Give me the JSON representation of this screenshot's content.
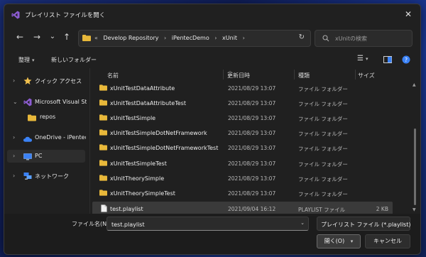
{
  "dialog": {
    "title": "プレイリスト ファイルを開く",
    "close_glyph": "✕"
  },
  "nav": {
    "back": "←",
    "forward": "→",
    "recent": "⌄",
    "up": "↑",
    "breadcrumb_prefix": "«",
    "breadcrumbs": [
      "Develop Repository",
      "iPentecDemo",
      "xUnit"
    ],
    "breadcrumb_sep": "›",
    "refresh": "↻",
    "search_placeholder": "xUnitの検索"
  },
  "commands": {
    "organize": "整理",
    "organize_caret": "▾",
    "new_folder": "新しいフォルダー",
    "view": "☰",
    "view_caret": "▾"
  },
  "sidebar": {
    "items": [
      {
        "label": "クイック アクセス",
        "chevron": "›"
      },
      {
        "label": "Microsoft Visual Stu",
        "chevron": "⌄"
      },
      {
        "label": "repos",
        "chevron": ""
      },
      {
        "label": "OneDrive - iPentec",
        "chevron": "›"
      },
      {
        "label": "PC",
        "chevron": "›"
      },
      {
        "label": "ネットワーク",
        "chevron": "›"
      }
    ]
  },
  "columns": {
    "name": "名前",
    "date": "更新日時",
    "type": "種類",
    "size": "サイズ"
  },
  "files": [
    {
      "name": "xUnitTestDataAttribute",
      "date": "2021/08/29 13:07",
      "type": "ファイル フォルダー",
      "size": ""
    },
    {
      "name": "xUnitTestDataAttributeTest",
      "date": "2021/08/29 13:07",
      "type": "ファイル フォルダー",
      "size": ""
    },
    {
      "name": "xUnitTestSimple",
      "date": "2021/08/29 13:07",
      "type": "ファイル フォルダー",
      "size": ""
    },
    {
      "name": "xUnitTestSimpleDotNetFramework",
      "date": "2021/08/29 13:07",
      "type": "ファイル フォルダー",
      "size": ""
    },
    {
      "name": "xUnitTestSimpleDotNetFrameworkTest",
      "date": "2021/08/29 13:07",
      "type": "ファイル フォルダー",
      "size": ""
    },
    {
      "name": "xUnitTestSimpleTest",
      "date": "2021/08/29 13:07",
      "type": "ファイル フォルダー",
      "size": ""
    },
    {
      "name": "xUnitTheorySimple",
      "date": "2021/08/29 13:07",
      "type": "ファイル フォルダー",
      "size": ""
    },
    {
      "name": "xUnitTheorySimpleTest",
      "date": "2021/08/29 13:07",
      "type": "ファイル フォルダー",
      "size": ""
    },
    {
      "name": "test.playlist",
      "date": "2021/09/04 16:12",
      "type": "PLAYLIST ファイル",
      "size": "2 KB"
    }
  ],
  "footer": {
    "filename_label": "ファイル名(N):",
    "filename_value": "test.playlist",
    "filetype_value": "プレイリスト ファイル (*.playlist)",
    "dropdown_glyph": "⌄",
    "open_label": "開く(O)",
    "open_caret": "▾",
    "cancel_label": "キャンセル"
  },
  "colors": {
    "folder": "#e8b83a",
    "accent_blue": "#3b82f6",
    "vs_purple": "#8c5cd1"
  }
}
